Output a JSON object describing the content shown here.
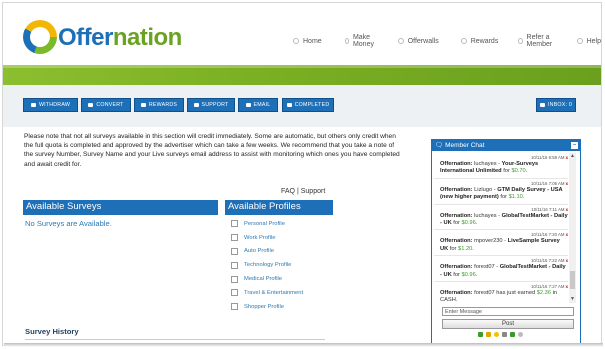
{
  "header": {
    "logo_part1": "Offer",
    "logo_part2": "nation",
    "nav": [
      "Home",
      "Make Money",
      "Offerwalls",
      "Rewards",
      "Refer a Member",
      "Help"
    ]
  },
  "actions": {
    "withdraw": "WITHDRAW",
    "convert": "CONVERT",
    "rewards": "REWARDS",
    "support": "SUPPORT",
    "email": "EMAIL",
    "completed": "COMPLETED",
    "inbox": "INBOX: 0"
  },
  "notice": "Please note that not all surveys available in this section will credit immediately. Some are automatic, but others only credit when the full quota is completed and approved by the advertiser which can take a few weeks. We recommend that you take a note of the survey Number, Survey Name and your Live surveys email address to assist with monitoring which ones you have completed and await credit for.",
  "links": {
    "faq": "FAQ",
    "sep": "|",
    "support": "Support"
  },
  "surveys": {
    "title": "Available Surveys",
    "empty": "No Surveys are Available."
  },
  "profiles": {
    "title": "Available Profiles",
    "items": [
      "Personal Profile",
      "Work Profile",
      "Auto Profile",
      "Technology Profile",
      "Medical Profile",
      "Travel & Entertainment",
      "Shopper Profile"
    ]
  },
  "history": {
    "title": "Survey History"
  },
  "chat": {
    "title": "Member Chat",
    "messages": [
      {
        "time": "10/11/16 6:58 AM",
        "user": "Offernation:",
        "text": "luchayes - ",
        "bold": "Your-Surveys International Unlimited",
        "mid": " for ",
        "amount": "$0.70",
        "tail": "."
      },
      {
        "time": "10/11/16 7:06 AM",
        "user": "Offernation:",
        "text": "Lizlugo - ",
        "bold": "GTM Daily Survey - USA (new higher payment)",
        "mid": " for ",
        "amount": "$1.10",
        "tail": "."
      },
      {
        "time": "10/11/16 7:11 AM",
        "user": "Offernation:",
        "text": "luchayes - ",
        "bold": "GlobalTestMarket - Daily - UK",
        "mid": " for ",
        "amount": "$0.96",
        "tail": "."
      },
      {
        "time": "10/11/16 7:20 AM",
        "user": "Offernation:",
        "text": "mpover230 - ",
        "bold": "LiveSample Survey UK",
        "mid": " for ",
        "amount": "$1.20",
        "tail": "."
      },
      {
        "time": "10/11/16 7:22 AM",
        "user": "Offernation:",
        "text": "forest07 - ",
        "bold": "GlobalTestMarket - Daily - UK",
        "mid": " for ",
        "amount": "$0.96",
        "tail": "."
      },
      {
        "time": "10/11/16 7:27 AM",
        "user": "Offernation:",
        "text": "forest07 has just earned ",
        "bold": "",
        "mid": "",
        "amount": "$2.36",
        "tail": " in CASH."
      }
    ],
    "placeholder": "Enter Message",
    "post": "Post"
  },
  "colors": {
    "primary": "#1d6fb8",
    "green": "#7ab929",
    "amount": "#3a9c2a"
  }
}
